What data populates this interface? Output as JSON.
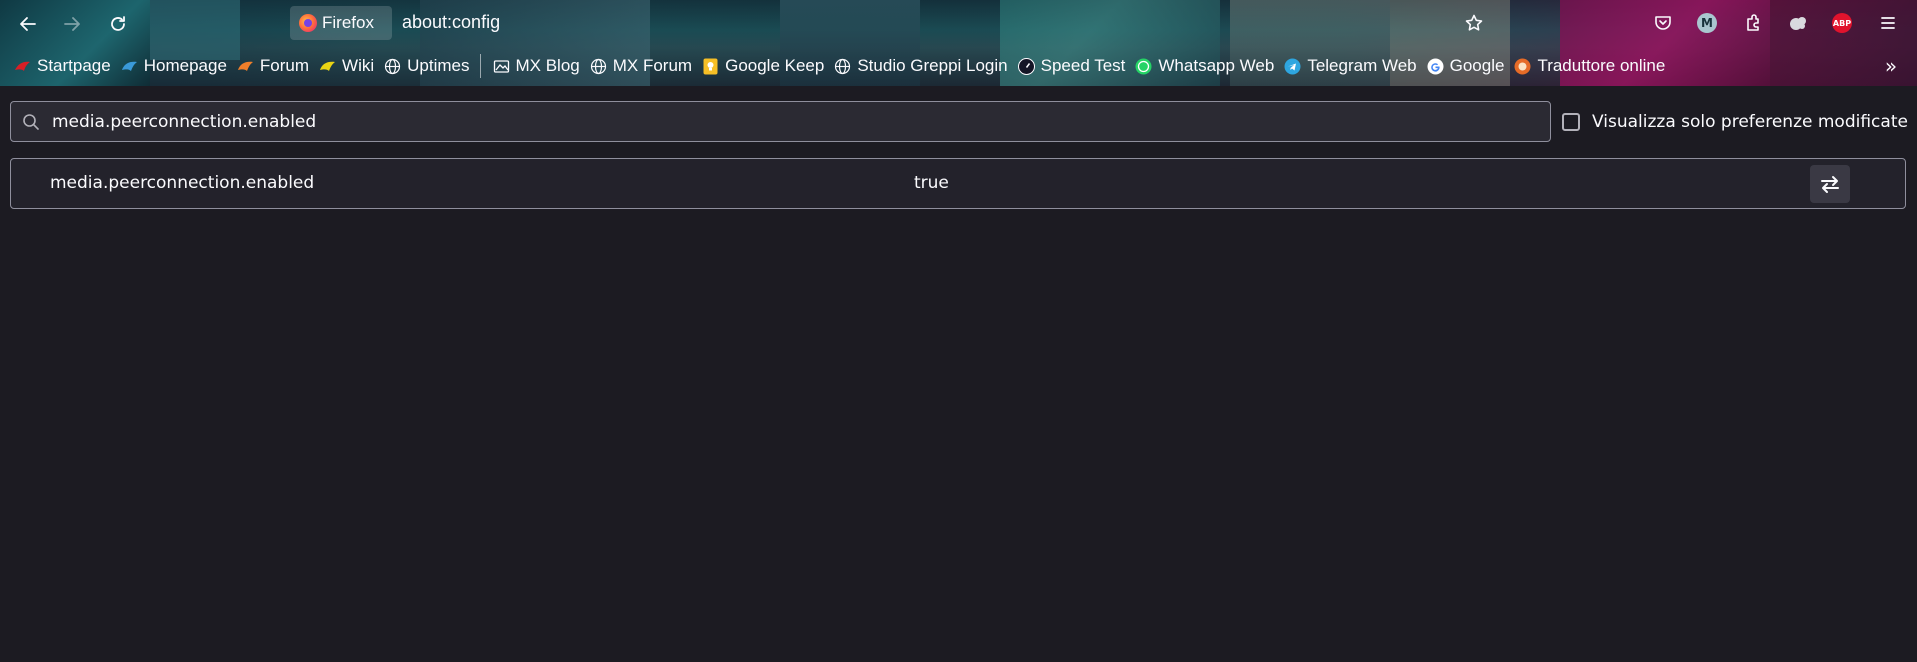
{
  "browser": {
    "identity_label": "Firefox",
    "url": "about:config"
  },
  "icons": {
    "back": "back-arrow-icon",
    "forward": "forward-arrow-icon",
    "reload": "reload-icon",
    "bookmark_star": "star-icon",
    "pocket": "pocket-icon",
    "account": "account-icon",
    "extensions": "extensions-icon",
    "extension_puzzle": "puzzle-icon",
    "adblock": "abp-icon",
    "menu": "hamburger-menu-icon"
  },
  "extension_badges": {
    "account_letter": "M",
    "adblock_text": "ABP"
  },
  "bookmarks": [
    {
      "label": "Startpage",
      "icon": "startpage-icon"
    },
    {
      "label": "Homepage",
      "icon": "homepage-icon"
    },
    {
      "label": "Forum",
      "icon": "forum-icon"
    },
    {
      "label": "Wiki",
      "icon": "wiki-icon"
    },
    {
      "label": "Uptimes",
      "icon": "globe-icon"
    },
    {
      "label": "MX Blog",
      "icon": "blog-icon"
    },
    {
      "label": "MX Forum",
      "icon": "globe-icon"
    },
    {
      "label": "Google Keep",
      "icon": "keep-icon"
    },
    {
      "label": "Studio Greppi Login",
      "icon": "globe-icon"
    },
    {
      "label": "Speed Test",
      "icon": "speedtest-icon"
    },
    {
      "label": "Whatsapp Web",
      "icon": "whatsapp-icon"
    },
    {
      "label": "Telegram Web",
      "icon": "telegram-icon"
    },
    {
      "label": "Google",
      "icon": "google-icon"
    },
    {
      "label": "Traduttore online",
      "icon": "translator-icon"
    }
  ],
  "bookmarks_overflow": "»",
  "search": {
    "value": "media.peerconnection.enabled",
    "placeholder": ""
  },
  "modified_only": {
    "label": "Visualizza solo preferenze modificate",
    "checked": false
  },
  "preference": {
    "name": "media.peerconnection.enabled",
    "value": "true"
  },
  "colors": {
    "background": "#1c1b22",
    "field": "#2b2a33",
    "border": "#8f8f9d",
    "text": "#fbfbfe"
  }
}
